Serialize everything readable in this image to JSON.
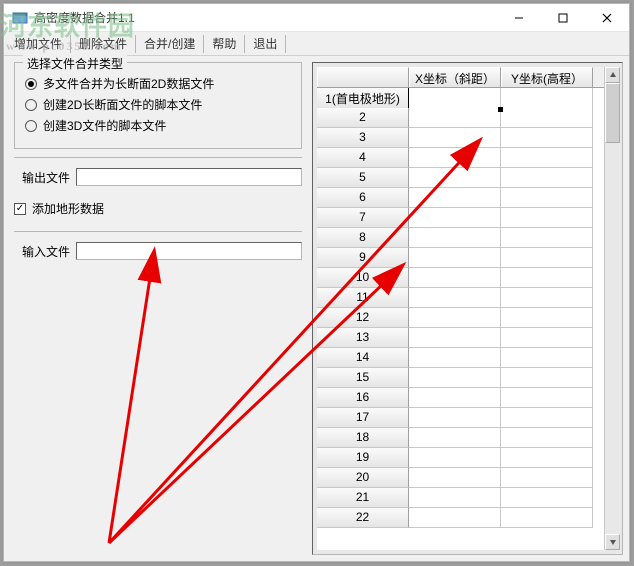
{
  "window": {
    "title": "高密度数据合并1.1"
  },
  "toolbar": {
    "items": [
      "增加文件",
      "删除文件",
      "合并/创建",
      "帮助",
      "退出"
    ]
  },
  "group": {
    "title": "选择文件合并类型",
    "options": [
      "多文件合并为长断面2D数据文件",
      "创建2D长断面文件的脚本文件",
      "创建3D文件的脚本文件"
    ],
    "selected": 0
  },
  "output": {
    "label": "输出文件",
    "value": ""
  },
  "add_terrain": {
    "label": "添加地形数据",
    "checked": true
  },
  "input": {
    "label": "输入文件",
    "value": ""
  },
  "table": {
    "headers": [
      "",
      "X坐标（斜距）",
      "Y坐标(高程）"
    ],
    "first_row_label": "1(首电极地形)",
    "rows": [
      "1(首电极地形)",
      "2",
      "3",
      "4",
      "5",
      "6",
      "7",
      "8",
      "9",
      "10",
      "11",
      "12",
      "13",
      "14",
      "15",
      "16",
      "17",
      "18",
      "19",
      "20",
      "21",
      "22"
    ]
  },
  "watermark": {
    "main": "河东软件园",
    "sub": "www.pc0359.com"
  }
}
